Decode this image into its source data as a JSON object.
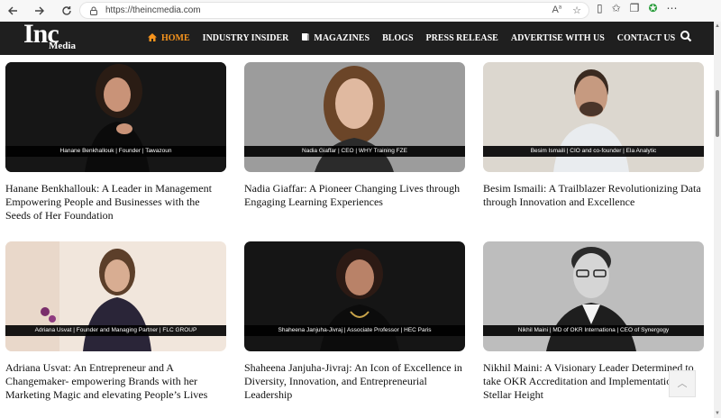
{
  "browser": {
    "url": "https://theincmedia.com"
  },
  "site": {
    "logo_main": "Inc",
    "logo_sub": "Media",
    "menu": [
      {
        "label": "HOME",
        "active": true,
        "icon": "home-icon"
      },
      {
        "label": "INDUSTRY INSIDER"
      },
      {
        "label": "MAGAZINES",
        "icon": "book-icon"
      },
      {
        "label": "BLOGS"
      },
      {
        "label": "PRESS RELEASE"
      },
      {
        "label": "ADVERTISE WITH US"
      },
      {
        "label": "CONTACT US"
      }
    ],
    "accent_color": "#f7941d",
    "nav_bg": "#1f1f1f"
  },
  "articles": [
    {
      "caption": "Hanane Benkhallouk | Founder | Tawazoun",
      "title": "Hanane Benkhallouk: A Leader in Management Empowering People and Businesses with the Seeds of Her Foundation"
    },
    {
      "caption": "Nadia Giaffar | CEO | WHY Training FZE",
      "title": "Nadia Giaffar: A Pioneer Changing Lives through Engaging Learning Experiences"
    },
    {
      "caption": "Besim Ismaili | CIO and co-founder | Ela Analytic",
      "title": "Besim Ismaili: A Trailblazer Revolutionizing Data through Innovation and Excellence"
    },
    {
      "caption": "Adriana Usvat | Founder and Managing Partner | FLC GROUP",
      "title": "Adriana Usvat: An Entrepreneur and A Changemaker- empowering Brands with her Marketing Magic and elevating People’s Lives"
    },
    {
      "caption": "Shaheena Janjuha-Jivraj | Associate Professor | HEC Paris",
      "title": "Shaheena Janjuha-Jivraj: An Icon of Excellence in Diversity, Innovation, and Entrepreneurial Leadership"
    },
    {
      "caption": "Nikhil Maini | MD of OKR Internationa | CEO of Synergogy",
      "title": "Nikhil Maini: A Visionary Leader Determined to take OKR Accreditation and Implementation to a Stellar Height"
    }
  ]
}
